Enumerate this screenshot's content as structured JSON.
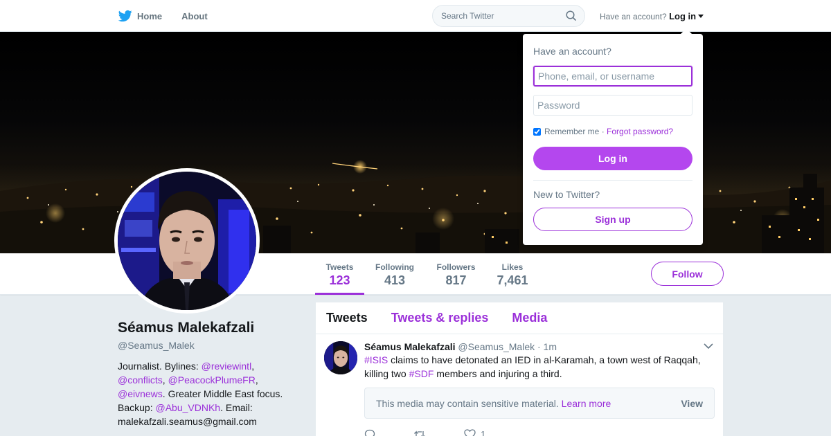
{
  "nav": {
    "logo_icon": "twitter-bird-icon",
    "home_label": "Home",
    "about_label": "About",
    "search_placeholder": "Search Twitter",
    "have_account": "Have an account?",
    "login_label": "Log in",
    "accent": "#1da1f2"
  },
  "login_dropdown": {
    "title": "Have an account?",
    "username_placeholder": "Phone, email, or username",
    "password_placeholder": "Password",
    "remember_label": "Remember me",
    "separator": " · ",
    "forgot_label": "Forgot password?",
    "login_button": "Log in",
    "new_label": "New to Twitter?",
    "signup_button": "Sign up",
    "remember_checked": true
  },
  "profile": {
    "name": "Séamus Malekafzali",
    "handle": "@Seamus_Malek",
    "bio": {
      "t1": "Journalist. Bylines: ",
      "l1": "@reviewintl",
      "t2": ",",
      "l2": "@conflicts",
      "t3": ", ",
      "l3": "@PeacockPlumeFR",
      "t4": ",",
      "l4": "@eivnews",
      "t5": ". Greater Middle East focus.",
      "t6": "Backup: ",
      "l5": "@Abu_VDNKh",
      "t7": ". Email:",
      "t8": "malekafzali.seamus@gmail.com"
    },
    "stats": [
      {
        "label": "Tweets",
        "value": "123"
      },
      {
        "label": "Following",
        "value": "413"
      },
      {
        "label": "Followers",
        "value": "817"
      },
      {
        "label": "Likes",
        "value": "7,461"
      }
    ],
    "follow_button": "Follow",
    "accent": "#9b30d9"
  },
  "timeline": {
    "tabs": [
      "Tweets",
      "Tweets & replies",
      "Media"
    ],
    "tweet": {
      "name": "Séamus Malekafzali",
      "handle": "@Seamus_Malek",
      "time": "· 1m",
      "hashtag1": "#ISIS",
      "text1": " claims to have detonated an IED in al-Karamah, a town west of Raqqah, killing two ",
      "hashtag2": "#SDF",
      "text2": " members and injuring a third.",
      "sensitive_text": "This media may contain sensitive material.",
      "learn_more": "Learn more",
      "view_label": "View",
      "like_count": "1"
    }
  }
}
